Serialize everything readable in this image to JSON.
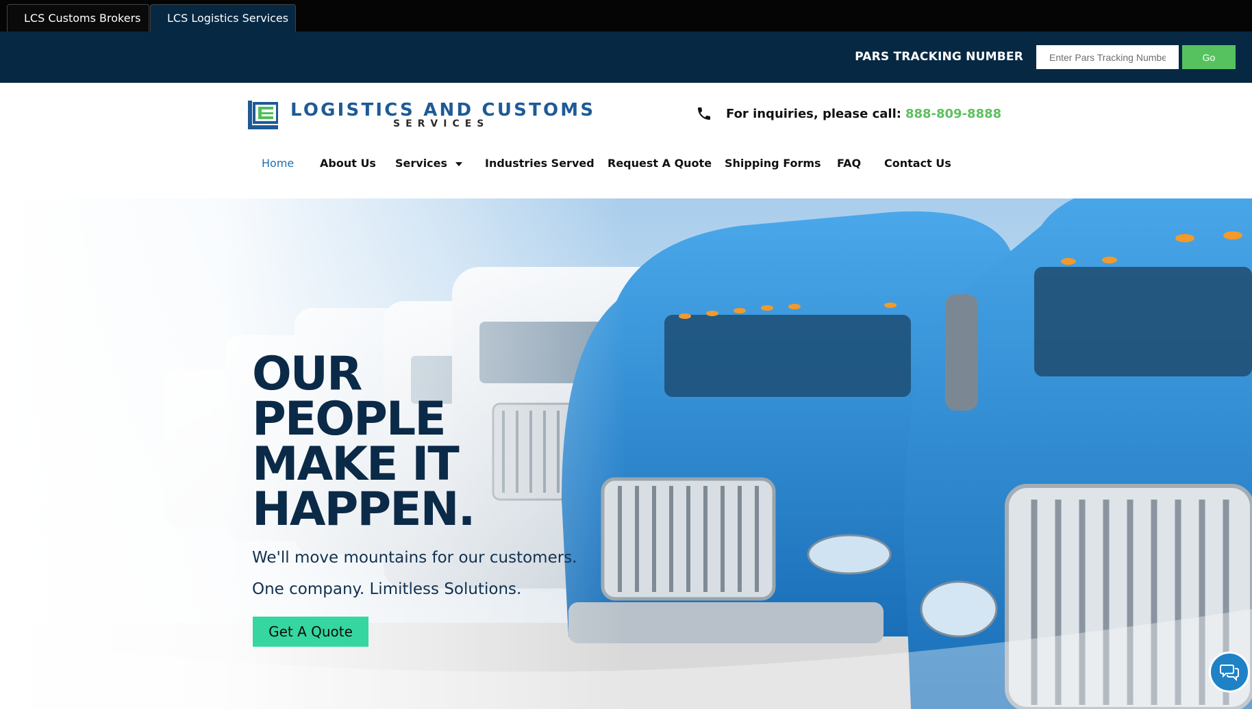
{
  "tabs": [
    {
      "label": "LCS Customs Brokers",
      "active": false
    },
    {
      "label": "LCS Logistics Services",
      "active": true
    }
  ],
  "tracking": {
    "label": "PARS TRACKING NUMBER",
    "placeholder": "Enter Pars Tracking Number",
    "value": "",
    "button_label": "Go"
  },
  "header": {
    "logo": {
      "title": "LOGISTICS AND CUSTOMS",
      "subtitle": "SERVICES",
      "icon": "lcs-logo-icon"
    },
    "phone": {
      "icon": "phone-icon",
      "text": "For inquiries, please call:",
      "number": "888-809-8888"
    }
  },
  "nav": {
    "items": [
      {
        "label": "Home",
        "active": true
      },
      {
        "label": "About Us"
      },
      {
        "label": "Services",
        "has_dropdown": true
      },
      {
        "label": "Industries Served"
      },
      {
        "label": "Request A Quote"
      },
      {
        "label": "Shipping Forms"
      },
      {
        "label": "FAQ"
      },
      {
        "label": "Contact Us"
      }
    ]
  },
  "hero": {
    "title_lines": [
      "OUR",
      "PEOPLE",
      "MAKE IT",
      "HAPPEN."
    ],
    "line1": "We'll move mountains for our customers.",
    "line2": "One company. Limitless Solutions.",
    "cta_label": "Get A Quote",
    "image": "fleet-of-blue-and-white-semi-trucks"
  },
  "chat": {
    "icon": "chat-bubbles-icon"
  },
  "colors": {
    "navy": "#062843",
    "green": "#56c25f",
    "phone_green": "#5cc05e",
    "nav_active": "#1f6fae",
    "cta": "#36d6a0",
    "chat": "#1f82c6",
    "truck_blue": "#2f8fd6"
  }
}
